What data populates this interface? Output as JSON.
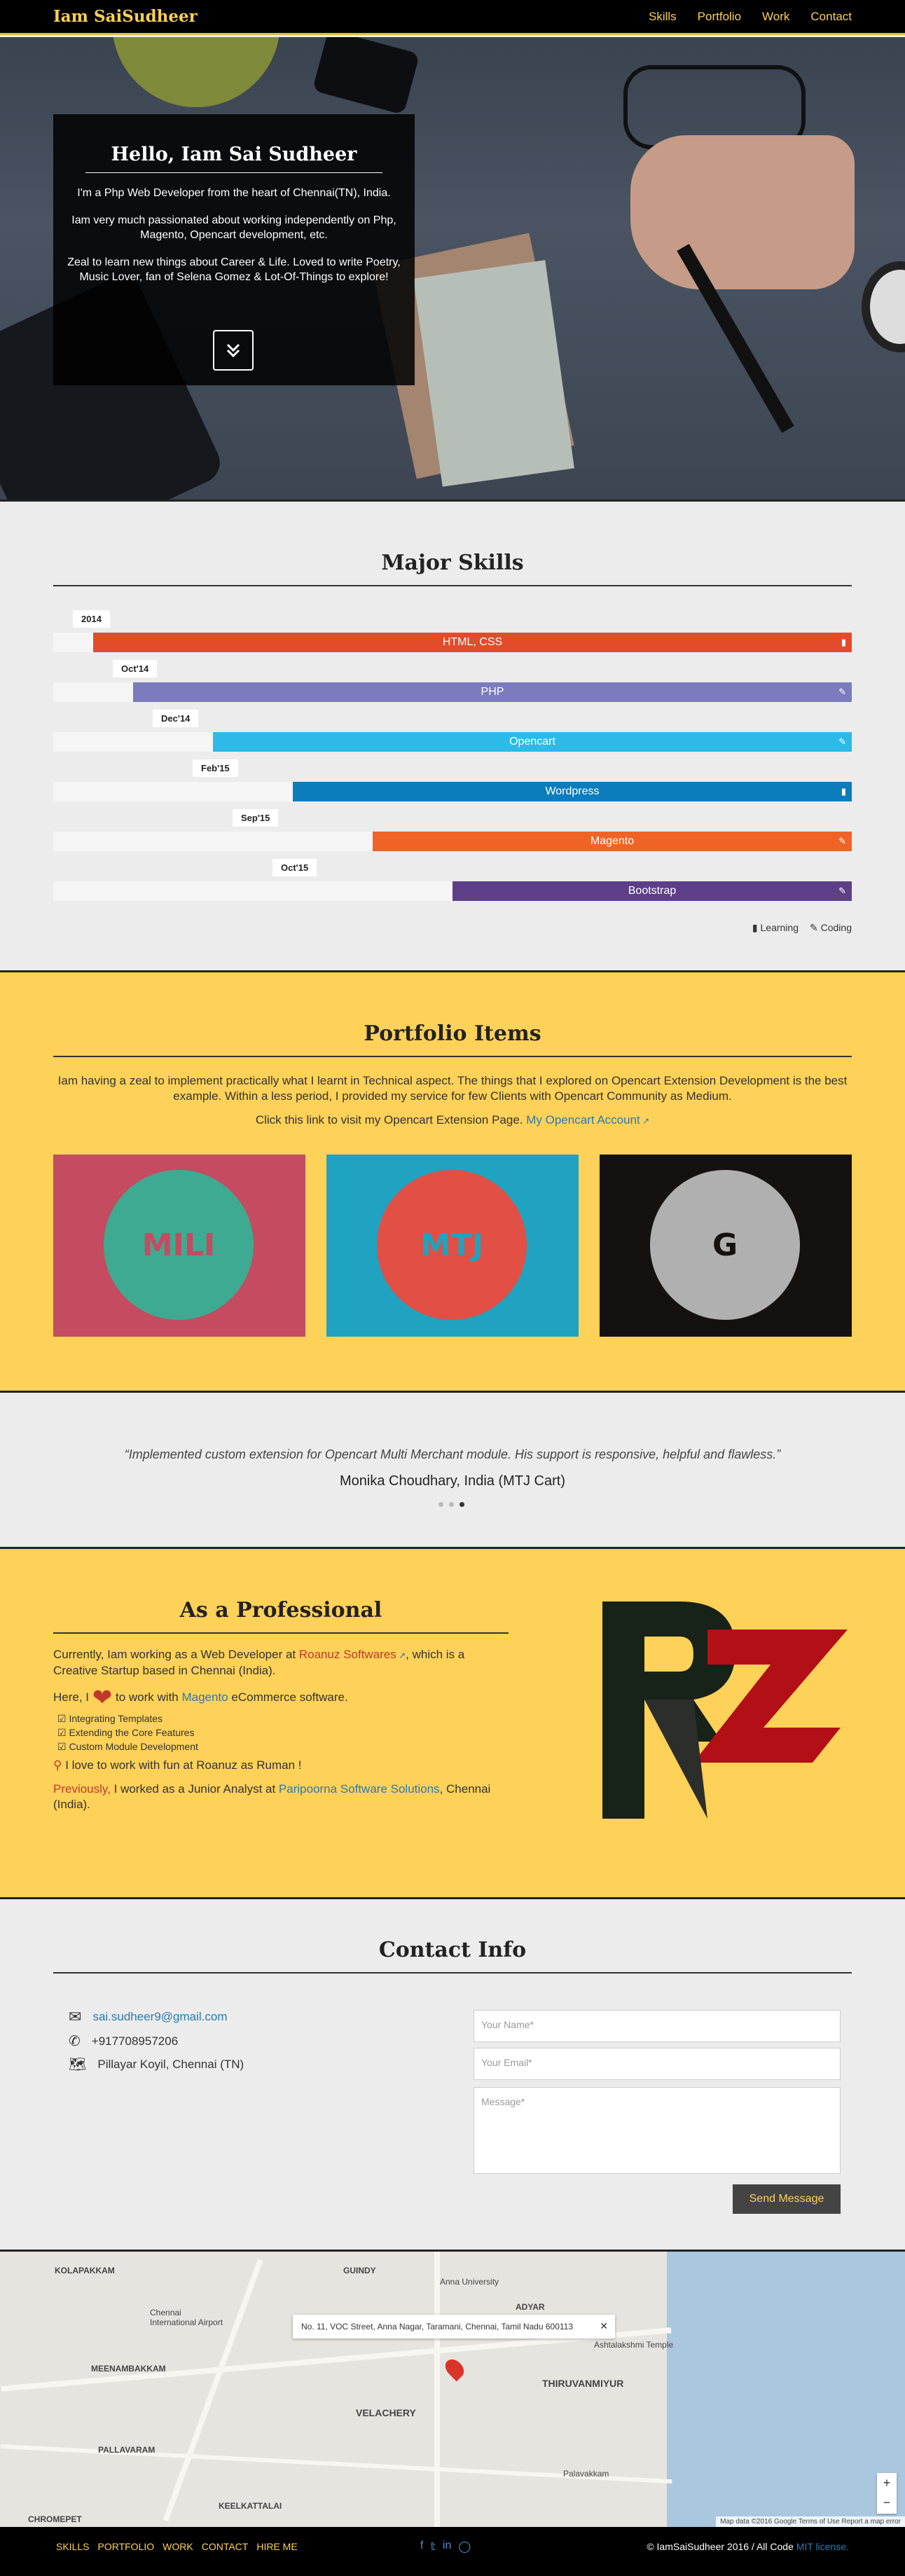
{
  "nav": {
    "brand": "Iam SaiSudheer",
    "links": [
      "Skills",
      "Portfolio",
      "Work",
      "Contact"
    ]
  },
  "hero": {
    "title": "Hello, Iam Sai Sudheer",
    "p1": "I'm a Php Web Developer from the heart of Chennai(TN), India.",
    "p2": "Iam very much passionated about working independently on Php, Magento, Opencart development, etc.",
    "p3": "Zeal to learn new things about Career & Life. Loved to write Poetry, Music Lover, fan of Selena Gomez & Lot-Of-Things to explore!"
  },
  "skills": {
    "title": "Major Skills",
    "items": [
      {
        "date": "2014",
        "label": "HTML, CSS",
        "start": 0.05,
        "color": "#e44b2b",
        "icon": "book-icon"
      },
      {
        "date": "Oct'14",
        "label": "PHP",
        "start": 0.1,
        "color": "#7b7bbd",
        "icon": "pencil-icon"
      },
      {
        "date": "Dec'14",
        "label": "Opencart",
        "start": 0.2,
        "color": "#2ebae8",
        "icon": "pencil-icon"
      },
      {
        "date": "Feb'15",
        "label": "Wordpress",
        "start": 0.3,
        "color": "#0b7dbd",
        "icon": "book-icon"
      },
      {
        "date": "Sep'15",
        "label": "Magento",
        "start": 0.4,
        "color": "#ef6426",
        "icon": "pencil-icon"
      },
      {
        "date": "Oct'15",
        "label": "Bootstrap",
        "start": 0.5,
        "color": "#5c3f87",
        "icon": "pencil-icon"
      }
    ],
    "legend_learning": "Learning",
    "legend_coding": "Coding"
  },
  "portfolio": {
    "title": "Portfolio Items",
    "text": "Iam having a zeal to implement practically what I learnt in Technical aspect. The things that I explored on Opencart Extension Development is the best example. Within a less period, I provided my service for few Clients with Opencart Community as Medium.",
    "link_prefix": "Click this link to visit my Opencart Extension Page.",
    "link_text": "My Opencart Account",
    "tiles": [
      {
        "label": "MILI",
        "bg": "#c44b60",
        "circle": "#3eaa91",
        "fg": "#c44b60"
      },
      {
        "label": "MTJ",
        "bg": "#1fa3c0",
        "circle": "#e24f45",
        "fg": "#1fa3c0"
      },
      {
        "label": "G",
        "bg": "#141110",
        "circle": "#b0b0b0",
        "fg": "#141110"
      }
    ]
  },
  "testimonial": {
    "quote": "“Implemented custom extension for Opencart Multi Merchant module. His support is responsive, helpful and flawless.”",
    "author": "Monika Choudhary, India (MTJ Cart)"
  },
  "professional": {
    "title": "As a Professional",
    "l1a": "Currently, Iam working as a Web Developer at",
    "l1b": "Roanuz Softwares",
    "l1c": ", which is a Creative Startup based in Chennai (India).",
    "l2a": "Here, I",
    "l2b": "to work with",
    "l2c": "Magento",
    "l2d": "eCommerce software.",
    "checks": [
      "Integrating Templates",
      "Extending the Core Features",
      "Custom Module Development"
    ],
    "l3": "I love to work with fun at Roanuz as Ruman !",
    "l4a": "Previously,",
    "l4b": "I worked as a Junior Analyst at",
    "l4c": "Paripoorna Software Solutions",
    "l4d": ", Chennai (India)."
  },
  "contact": {
    "title": "Contact Info",
    "email": "sai.sudheer9@gmail.com",
    "phone": "+917708957206",
    "address": "Pillayar Koyil, Chennai (TN)",
    "name_ph": "Your Name*",
    "email_ph": "Your Email*",
    "msg_ph": "Message*",
    "send": "Send Message"
  },
  "map": {
    "info": "No. 11, VOC Street, Anna Nagar, Taramani, Chennai, Tamil Nadu 600113",
    "labels": [
      "KOLAPAKKAM",
      "GUINDY",
      "ADYAR",
      "THIRUVANMIYUR",
      "VELACHERY",
      "MEENAMBAKKAM",
      "Chennai International Airport",
      "KEELKATTALAI",
      "CHROMEPET",
      "PALLAVARAM",
      "Anna University",
      "Ashtalakshmi Temple",
      "Palavakkam"
    ],
    "footer": "Map data ©2016 Google   Terms of Use   Report a map error"
  },
  "footer": {
    "links": [
      "SKILLS",
      "PORTFOLIO",
      "WORK",
      "CONTACT",
      "HIRE ME"
    ],
    "copy": "© IamSaiSudheer 2016 / All Code",
    "license": "MIT license."
  }
}
